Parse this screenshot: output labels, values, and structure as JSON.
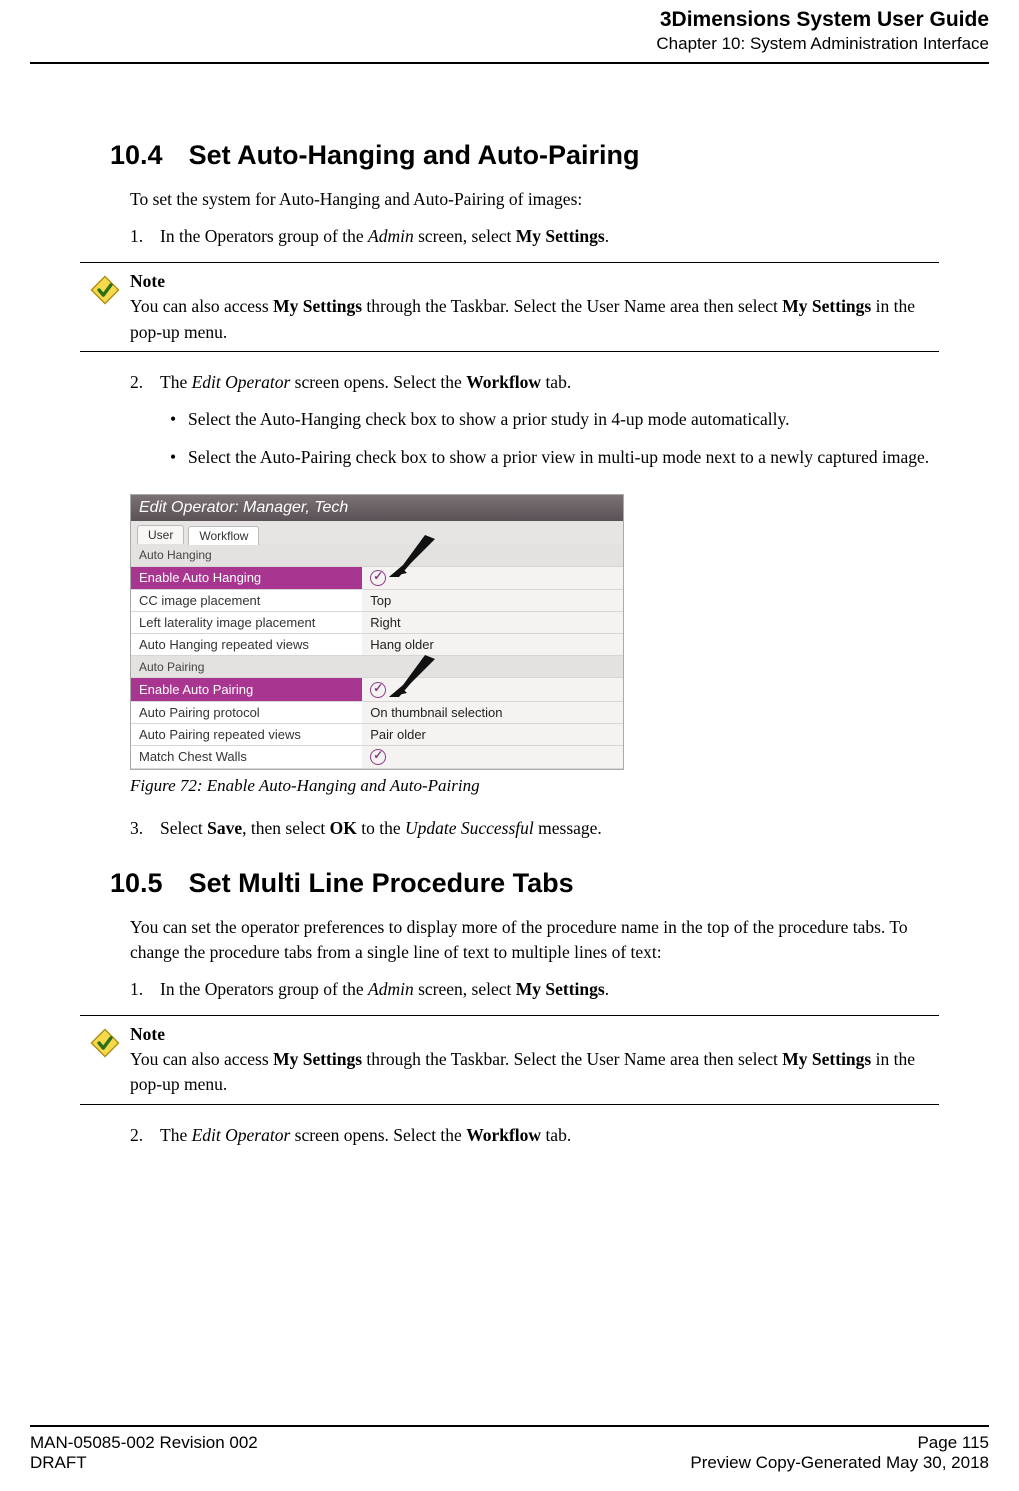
{
  "header": {
    "title": "3Dimensions System User Guide",
    "chapter": "Chapter 10: System Administration Interface"
  },
  "section_104": {
    "number": "10.4",
    "title": "Set Auto-Hanging and Auto-Pairing",
    "intro": "To set the system for Auto-Hanging and Auto-Pairing of images:",
    "step1_num": "1.",
    "step1_pre": "In the Operators group of the ",
    "step1_ital": "Admin",
    "step1_mid": " screen, select ",
    "step1_bold": "My Settings",
    "step1_post": ".",
    "note_label": "Note",
    "note_pre": "You can also access ",
    "note_b1": "My Settings",
    "note_mid": " through the Taskbar. Select the User Name area then select ",
    "note_b2": "My Settings",
    "note_post": " in the pop-up menu.",
    "step2_num": "2.",
    "step2_pre": "The ",
    "step2_ital": "Edit Operator",
    "step2_mid": " screen opens. Select the ",
    "step2_bold": "Workflow",
    "step2_post": " tab.",
    "bullet1": "Select the Auto-Hanging check box to show a prior study in 4-up mode automatically.",
    "bullet2": "Select the Auto-Pairing check box to show a prior view in multi-up mode next to a newly captured image.",
    "step3_num": "3.",
    "step3_pre": "Select ",
    "step3_b1": "Save",
    "step3_mid": ", then select ",
    "step3_b2": "OK",
    "step3_mid2": " to the ",
    "step3_ital": "Update Successful",
    "step3_post": " message."
  },
  "screenshot": {
    "title": "Edit Operator: Manager, Tech",
    "tab_user": "User",
    "tab_workflow": "Workflow",
    "group1": "Auto Hanging",
    "r1_lbl": "Enable Auto Hanging",
    "r2_lbl": "CC image placement",
    "r2_val": "Top",
    "r3_lbl": "Left laterality image placement",
    "r3_val": "Right",
    "r4_lbl": "Auto Hanging repeated views",
    "r4_val": "Hang older",
    "group2": "Auto Pairing",
    "r5_lbl": "Enable Auto Pairing",
    "r6_lbl": "Auto Pairing protocol",
    "r6_val": "On thumbnail selection",
    "r7_lbl": "Auto Pairing repeated views",
    "r7_val": "Pair older",
    "r8_lbl": "Match Chest Walls"
  },
  "figure_caption": "Figure 72: Enable Auto-Hanging and Auto-Pairing",
  "section_105": {
    "number": "10.5",
    "title": "Set Multi Line Procedure Tabs",
    "intro": "You can set the operator preferences to display more of the procedure name in the top of the procedure tabs. To change the procedure tabs from a single line of text to multiple lines of text:",
    "step1_num": "1.",
    "step1_pre": "In the Operators group of the ",
    "step1_ital": "Admin",
    "step1_mid": " screen, select ",
    "step1_bold": "My Settings",
    "step1_post": ".",
    "note_label": "Note",
    "note_pre": "You can also access ",
    "note_b1": "My Settings",
    "note_mid": " through the Taskbar. Select the User Name area then select ",
    "note_b2": "My Settings",
    "note_post": " in the pop-up menu.",
    "step2_num": "2.",
    "step2_pre": "The ",
    "step2_ital": "Edit Operator",
    "step2_mid": " screen opens. Select the ",
    "step2_bold": "Workflow",
    "step2_post": " tab."
  },
  "footer": {
    "left1": "MAN-05085-002 Revision 002",
    "left2": "DRAFT",
    "right1": "Page 115",
    "right2": "Preview Copy-Generated May 30, 2018"
  }
}
